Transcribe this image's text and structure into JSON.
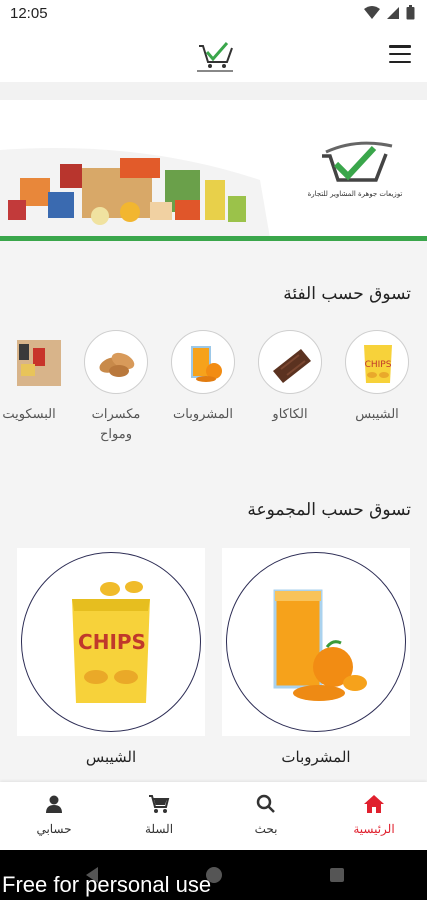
{
  "status": {
    "time": "12:05"
  },
  "header": {
    "menu_icon": "hamburger-menu-icon",
    "logo_icon": "cart-check-logo-icon"
  },
  "banner": {
    "brand_text": "توزيعات جوهرة المشاوير للتجارة"
  },
  "categories_section": {
    "title": "تسوق حسب الفئة",
    "items": [
      {
        "label": "الشيبس",
        "icon": "chips-icon"
      },
      {
        "label": "الكاكاو",
        "icon": "chocolate-icon"
      },
      {
        "label": "المشروبات",
        "icon": "juice-icon"
      },
      {
        "label": "مكسرات ومواح",
        "icon": "peanuts-icon"
      },
      {
        "label": "البسكويت",
        "icon": "biscuits-icon"
      }
    ]
  },
  "groups_section": {
    "title": "تسوق حسب المجموعة",
    "items": [
      {
        "label": "المشروبات",
        "icon": "orange-juice-icon"
      },
      {
        "label": "الشيبس",
        "icon": "chips-bag-icon"
      }
    ]
  },
  "bottom_nav": {
    "items": [
      {
        "label": "الرئيسية",
        "icon": "home-icon",
        "active": true
      },
      {
        "label": "بحث",
        "icon": "search-icon"
      },
      {
        "label": "السلة",
        "icon": "cart-icon"
      },
      {
        "label": "حسابي",
        "icon": "person-icon"
      }
    ]
  },
  "colors": {
    "accent": "#e0202e",
    "brand_green": "#3aa64b",
    "circle_border": "#2d2d55"
  },
  "watermark": "Free for personal use"
}
